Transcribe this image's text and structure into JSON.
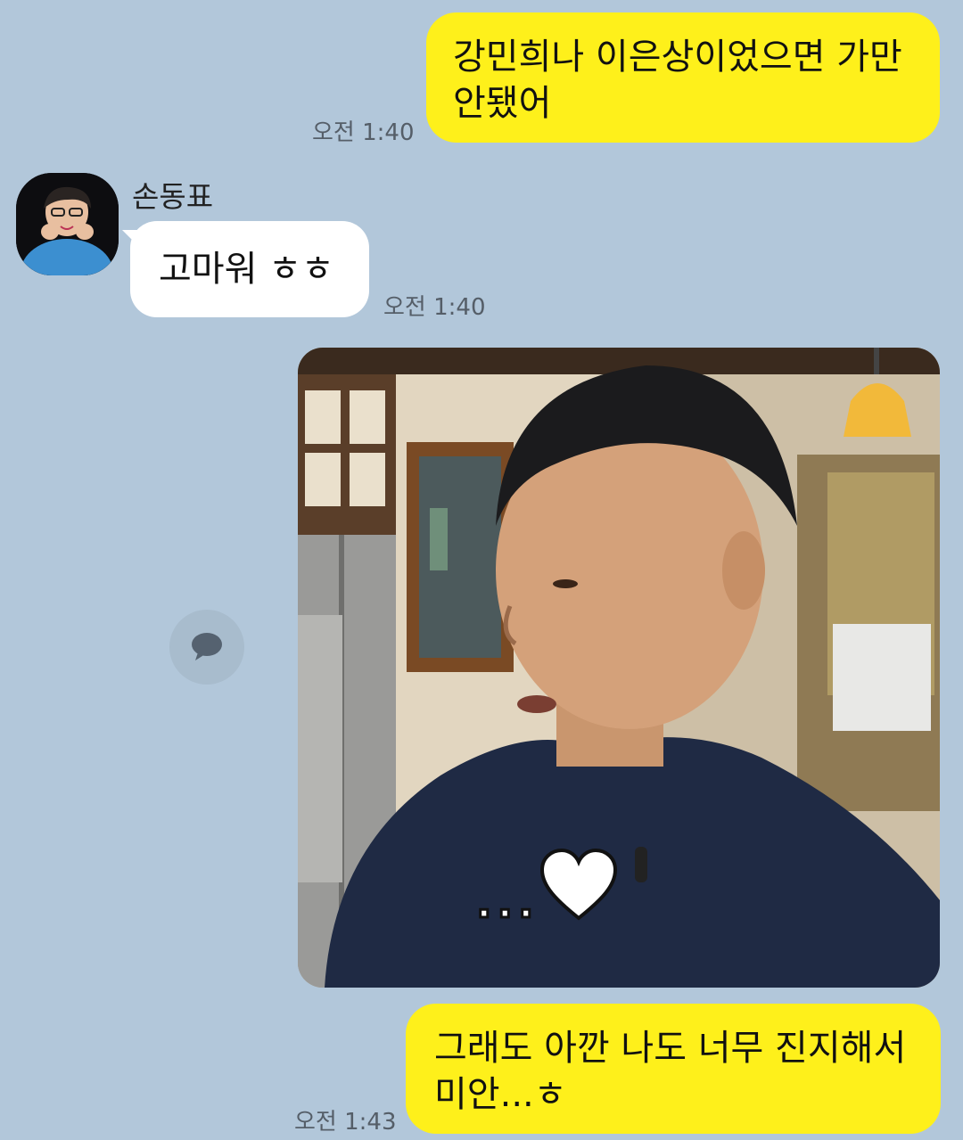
{
  "messages": {
    "m1": {
      "text": "강민희나 이은상이었으면 가만\n안됐어",
      "time": "오전 1:40"
    },
    "m2": {
      "sender": "손동표",
      "text": "고마워 ㅎㅎ",
      "time": "오전 1:40"
    },
    "m3": {
      "caption": "...♡"
    },
    "m4": {
      "text": "그래도 아깐 나도 너무 진지해서\n미안...ㅎ",
      "time": "오전 1:43"
    }
  },
  "icons": {
    "avatar": "profile-photo",
    "share": "speech-bubble-icon",
    "heart": "heart-icon"
  },
  "colors": {
    "background": "#b2c7da",
    "my_bubble": "#fef01b",
    "other_bubble": "#ffffff"
  }
}
